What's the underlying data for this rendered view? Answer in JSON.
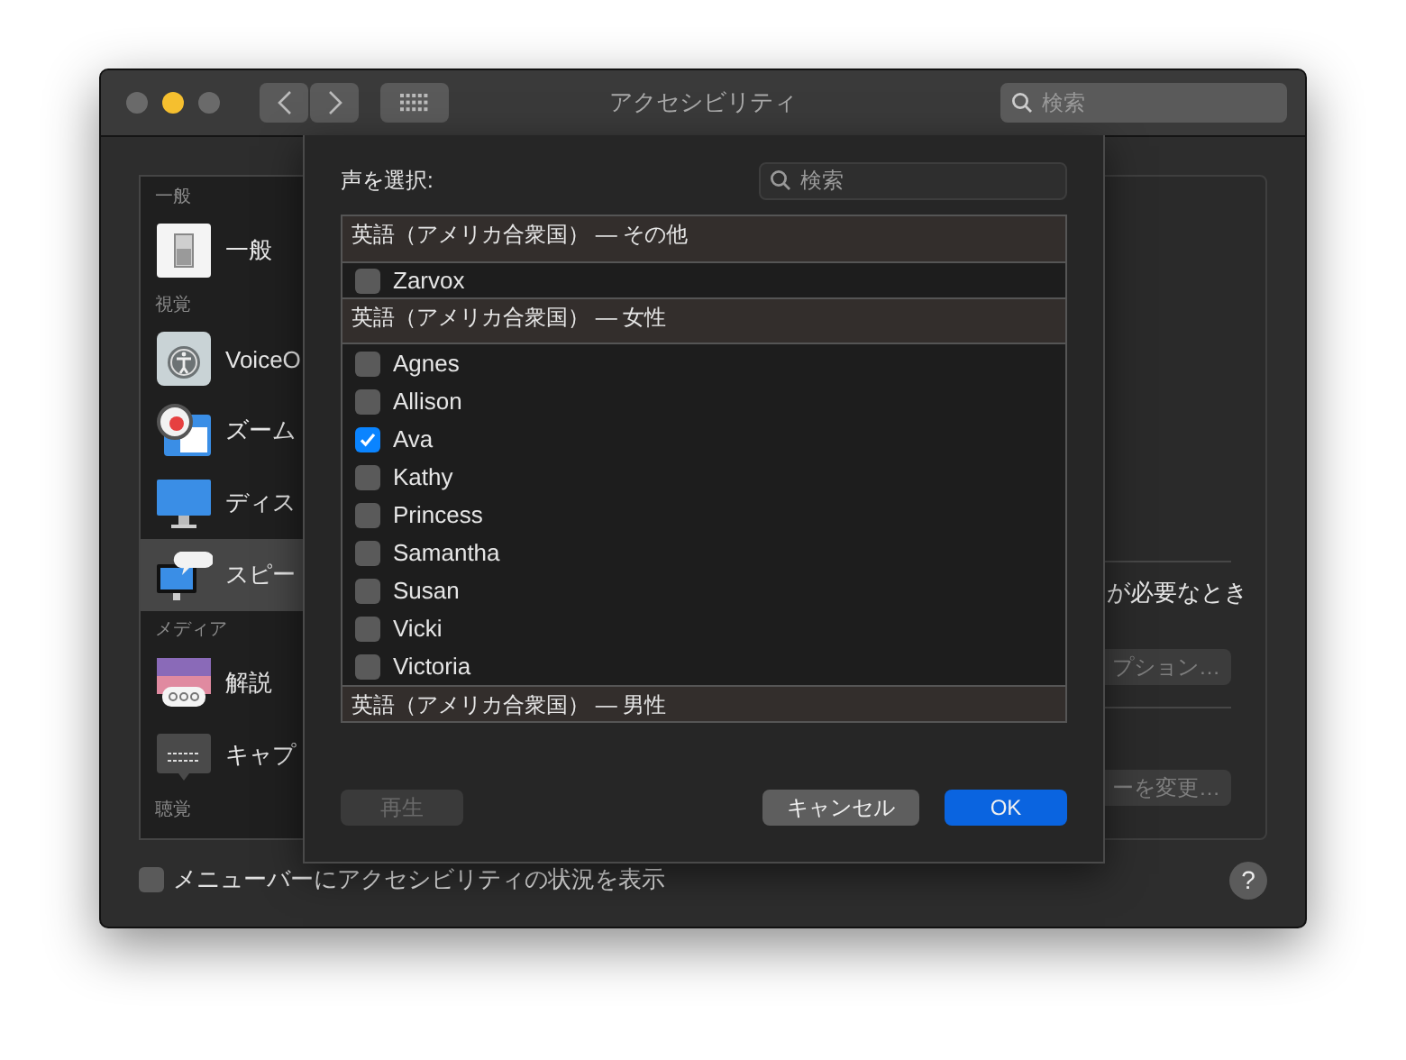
{
  "window": {
    "title": "アクセシビリティ",
    "search_placeholder": "検索"
  },
  "sidebar": {
    "sections": [
      {
        "heading": "一般",
        "items": [
          {
            "label": "一般",
            "kind": "switch",
            "selected": false
          }
        ]
      },
      {
        "heading": "視覚",
        "items": [
          {
            "label": "VoiceO",
            "kind": "voiceover",
            "selected": false
          },
          {
            "label": "ズーム",
            "kind": "zoom",
            "selected": false
          },
          {
            "label": "ディス",
            "kind": "display",
            "selected": false
          },
          {
            "label": "スピー",
            "kind": "speech",
            "selected": true
          }
        ]
      },
      {
        "heading": "メディア",
        "items": [
          {
            "label": "解説",
            "kind": "descriptions",
            "selected": false
          },
          {
            "label": "キャプ",
            "kind": "captions",
            "selected": false
          }
        ]
      },
      {
        "heading": "聴覚"
      }
    ]
  },
  "right_panel": {
    "text": "が必要なとき",
    "buttons": [
      "プション…",
      "ーを変更…"
    ]
  },
  "bottom": {
    "checkbox": {
      "label": "メニューバーにアクセシビリティの状況を表示",
      "checked": false
    },
    "help": "?"
  },
  "sheet": {
    "label": "声を選択:",
    "search_placeholder": "検索",
    "groups": [
      {
        "heading": "英語（アメリカ合衆国） — その他",
        "voices": [
          {
            "name": "Zarvox",
            "checked": false
          }
        ]
      },
      {
        "heading": "英語（アメリカ合衆国） — 女性",
        "voices": [
          {
            "name": "Agnes",
            "checked": false
          },
          {
            "name": "Allison",
            "checked": false
          },
          {
            "name": "Ava",
            "checked": true
          },
          {
            "name": "Kathy",
            "checked": false
          },
          {
            "name": "Princess",
            "checked": false
          },
          {
            "name": "Samantha",
            "checked": false
          },
          {
            "name": "Susan",
            "checked": false
          },
          {
            "name": "Vicki",
            "checked": false
          },
          {
            "name": "Victoria",
            "checked": false
          }
        ]
      },
      {
        "heading": "英語（アメリカ合衆国） — 男性"
      }
    ],
    "buttons": [
      {
        "label": "再生",
        "disabled": true,
        "default": false
      },
      {
        "label": "キャンセル",
        "disabled": false,
        "default": false
      },
      {
        "label": "OK",
        "disabled": false,
        "default": true
      }
    ]
  }
}
